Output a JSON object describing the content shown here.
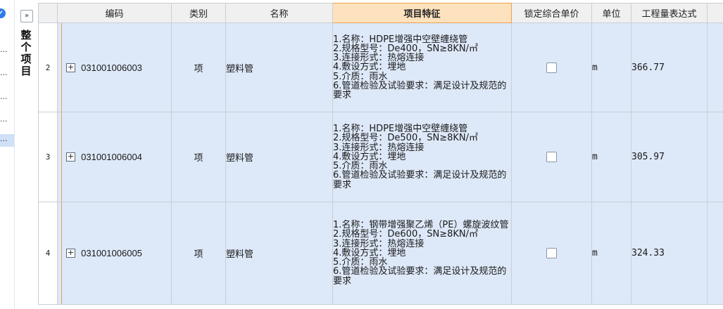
{
  "panel": {
    "collapse_glyph": "»",
    "vertical_title": "整个项目"
  },
  "left_strip": {
    "badge_glyph": "✔",
    "row_markers": [
      "...",
      "...",
      "...",
      "...",
      "..."
    ]
  },
  "table": {
    "columns": [
      "编码",
      "类别",
      "名称",
      "项目特征",
      "锁定综合单价",
      "单位",
      "工程量表达式"
    ],
    "highlighted_column": "项目特征",
    "rows": [
      {
        "index": "2",
        "expand_glyph": "+",
        "code": "031001006003",
        "type": "项",
        "name": "塑料管",
        "features": [
          "1.名称：HDPE增强中空壁缠绕管",
          "2.规格型号：De400，SN≥8KN/㎡",
          "3.连接形式：热熔连接",
          "4.敷设方式：埋地",
          "5.介质：雨水",
          "6.管道检验及试验要求：满足设计及规范的要求"
        ],
        "locked": false,
        "unit": "m",
        "quantity_expr": "366.77"
      },
      {
        "index": "3",
        "expand_glyph": "+",
        "code": "031001006004",
        "type": "项",
        "name": "塑料管",
        "features": [
          "1.名称：HDPE增强中空壁缠绕管",
          "2.规格型号：De500，SN≥8KN/㎡",
          "3.连接形式：热熔连接",
          "4.敷设方式：埋地",
          "5.介质：雨水",
          "6.管道检验及试验要求：满足设计及规范的要求"
        ],
        "locked": false,
        "unit": "m",
        "quantity_expr": "305.97"
      },
      {
        "index": "4",
        "expand_glyph": "+",
        "code": "031001006005",
        "type": "项",
        "name": "塑料管",
        "features": [
          "1.名称：钢带增强聚乙烯（PE）螺旋波纹管",
          "2.规格型号：De600，SN≥8KN/㎡",
          "3.连接形式：热熔连接",
          "4.敷设方式：埋地",
          "5.介质：雨水",
          "6.管道检验及试验要求：满足设计及规范的要求"
        ],
        "locked": false,
        "unit": "m",
        "quantity_expr": "324.33"
      }
    ]
  },
  "colors": {
    "row_bg": "#dde8f8",
    "header_bg": "#f0f0f0",
    "highlight_header_bg": "#fde2bd",
    "accent_blue": "#2e7be6"
  }
}
